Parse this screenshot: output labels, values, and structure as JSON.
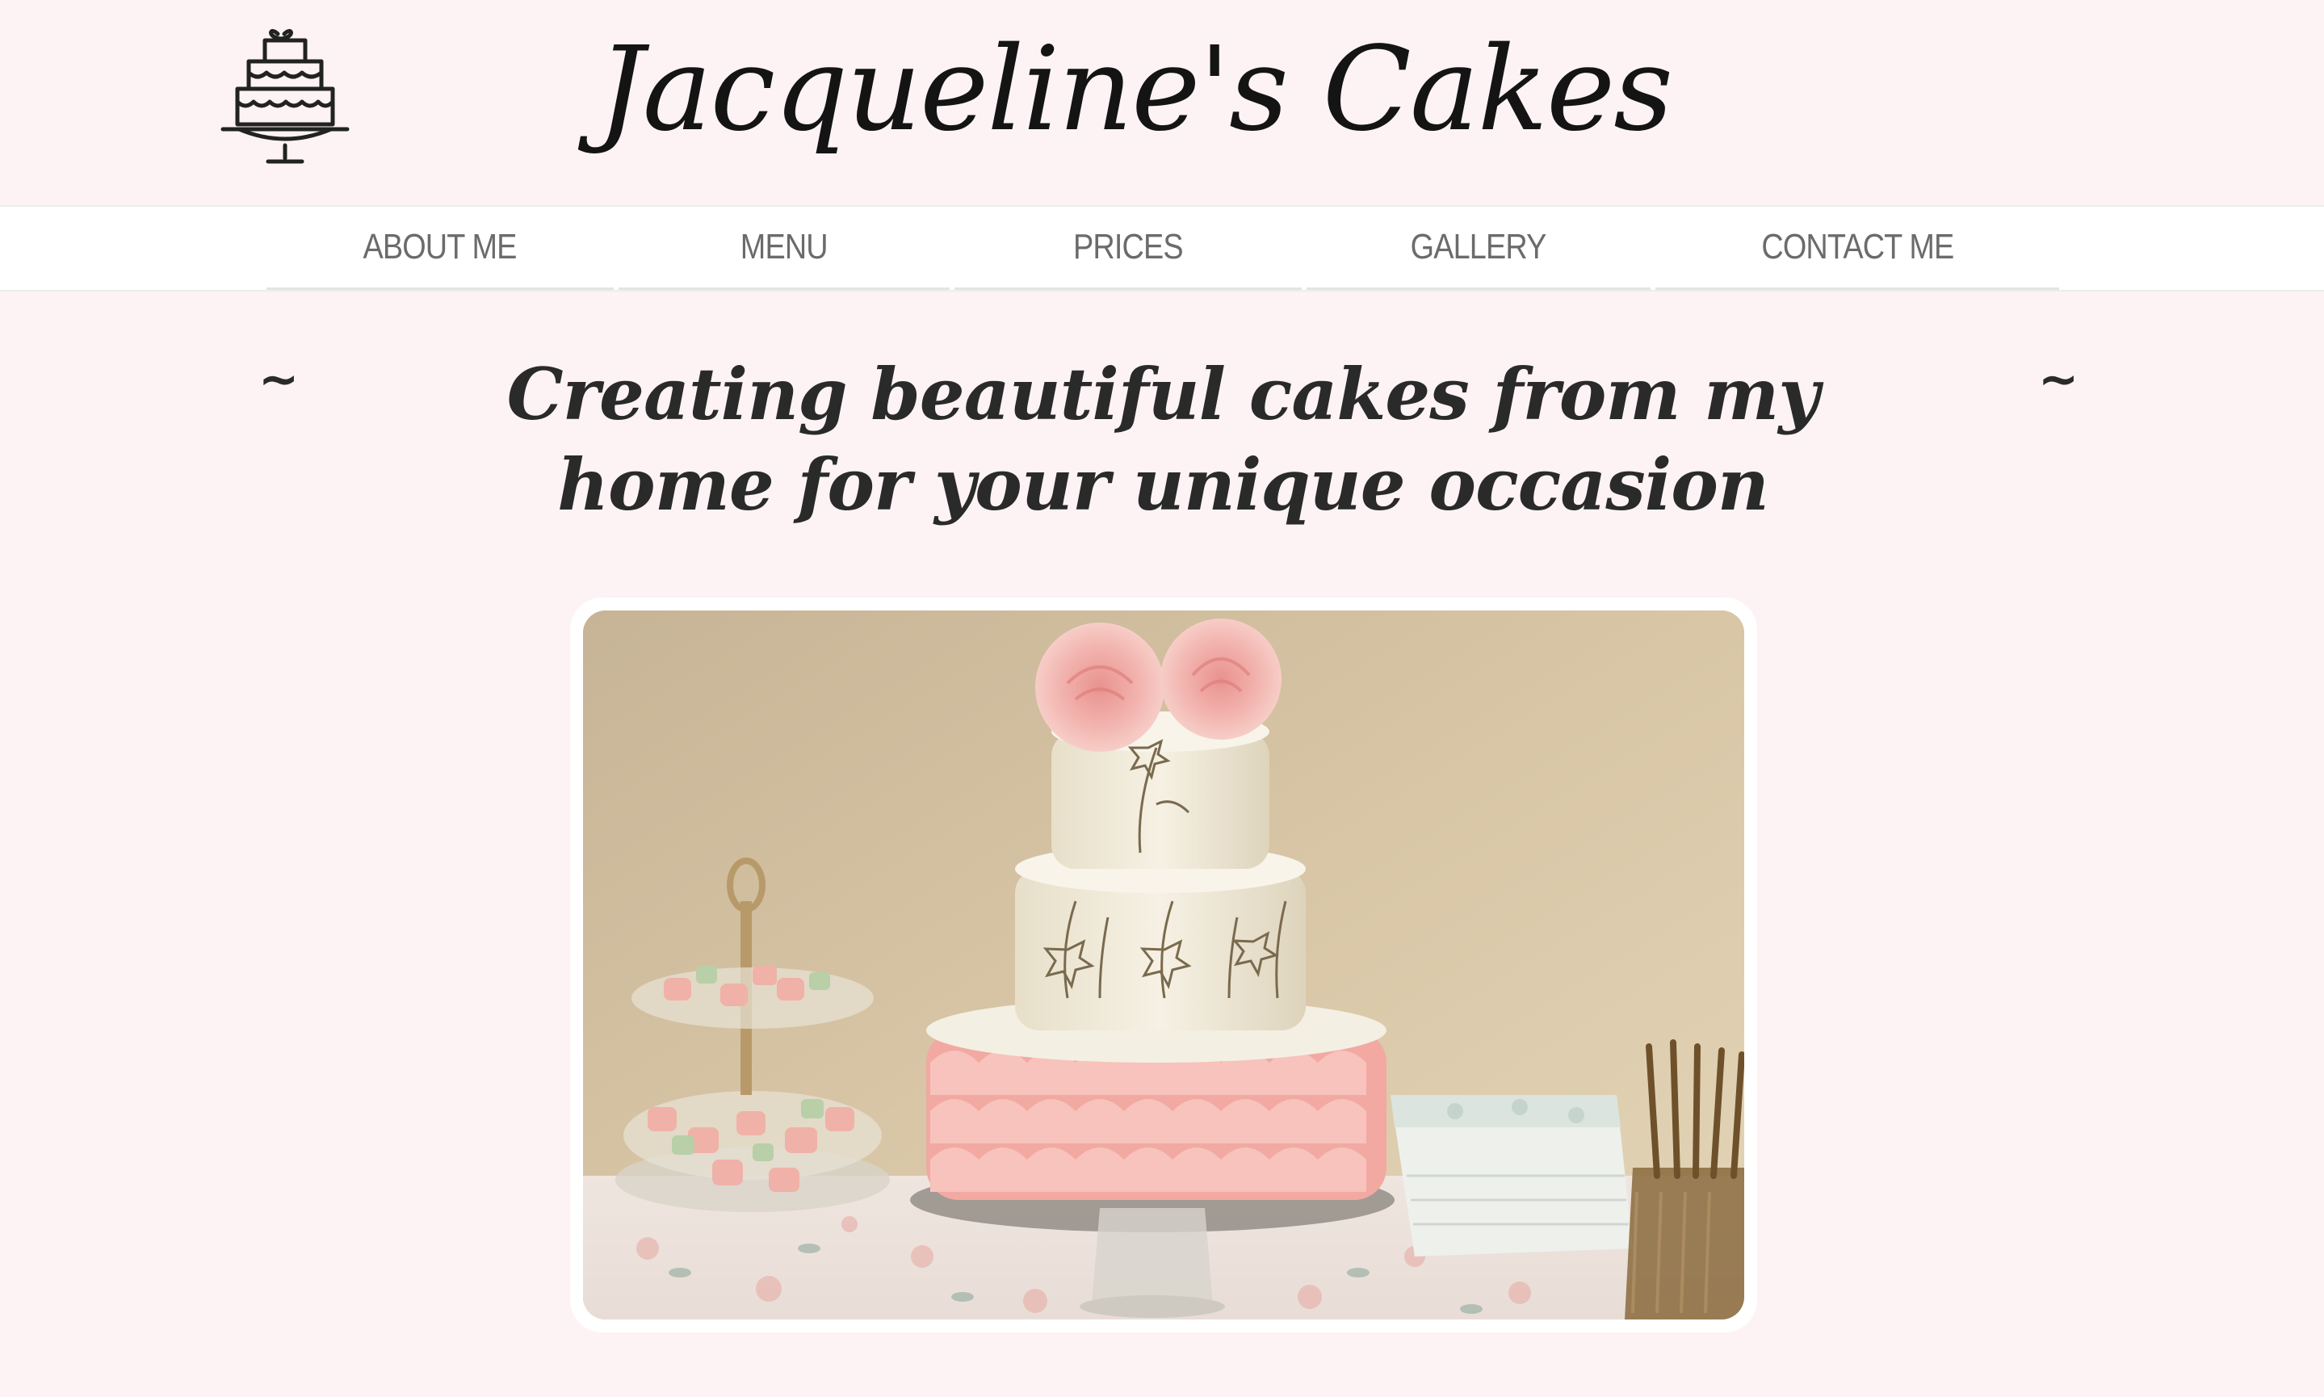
{
  "header": {
    "logo_icon": "tiered-cake-icon",
    "site_title": "Jacqueline's Cakes"
  },
  "nav": {
    "items": [
      {
        "label": "ABOUT ME"
      },
      {
        "label": "MENU"
      },
      {
        "label": "PRICES"
      },
      {
        "label": "GALLERY"
      },
      {
        "label": "CONTACT ME"
      }
    ]
  },
  "hero": {
    "tilde_left": "~",
    "tilde_right": "~",
    "tagline": "Creating beautiful cakes from my home for your unique occasion"
  },
  "colors": {
    "page_background": "#fdf3f4",
    "nav_background": "#ffffff",
    "nav_text": "#6b6b6b",
    "title_text": "#141414"
  }
}
